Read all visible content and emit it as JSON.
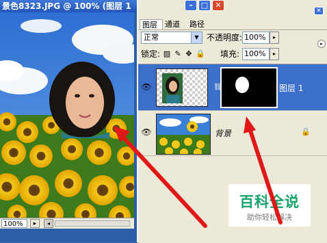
{
  "document": {
    "title": "景色8323.JPG @ 100% (图层 1",
    "zoom": "100%"
  },
  "layers_panel": {
    "tabs": [
      "图层",
      "通道",
      "路径"
    ],
    "blend_mode": "正常",
    "opacity_label": "不透明度:",
    "opacity_value": "100%",
    "lock_label": "锁定:",
    "fill_label": "填充:",
    "fill_value": "100%",
    "layers": [
      {
        "name": "图层 1",
        "selected": true
      },
      {
        "name": "背景",
        "selected": false
      }
    ]
  },
  "watermark": {
    "title": "百科全说",
    "subtitle": "助你轻松解决"
  },
  "colors": {
    "arrow": "#e01818",
    "selection": "#3c6fc9",
    "sky": "#3a7fd8",
    "watermark_text": "#18a36a"
  },
  "icons": [
    "eye-icon",
    "link-icon",
    "lock-icon",
    "brush-icon",
    "move-icon",
    "transparency-lock-icon",
    "panel-menu-icon",
    "minimize-icon",
    "maximize-icon",
    "close-icon",
    "dropdown-arrow-icon"
  ]
}
